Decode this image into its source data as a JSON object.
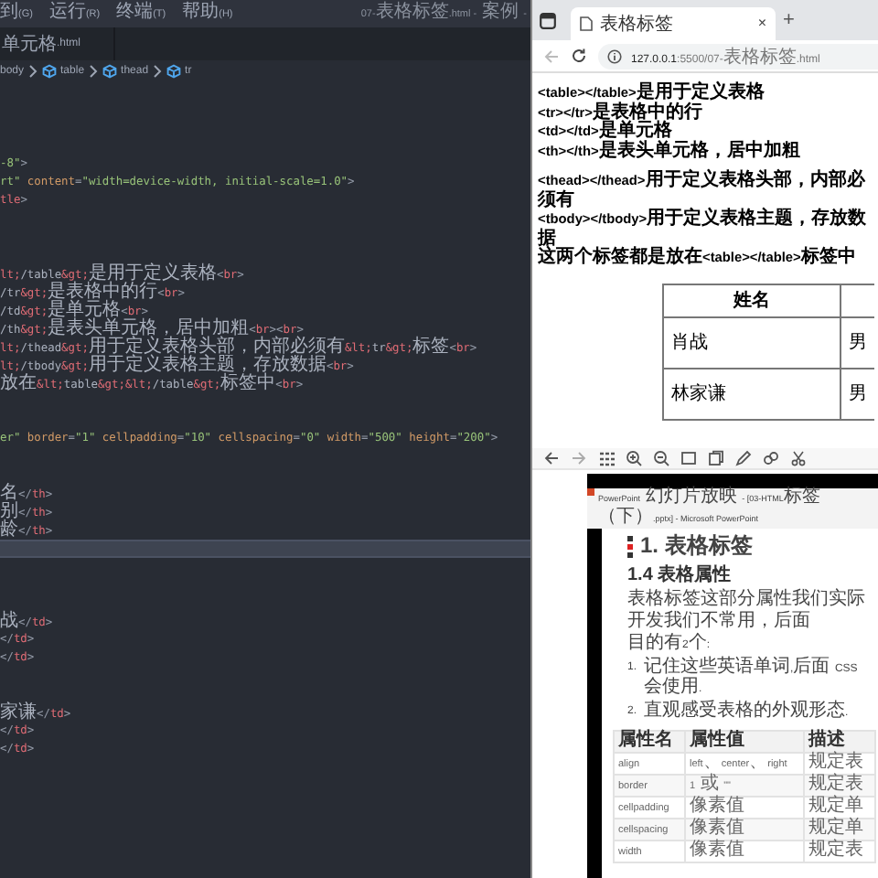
{
  "editor": {
    "menu": [
      "到(G)",
      "运行(R)",
      "终端(T)",
      "帮助(H)"
    ],
    "title": "07-表格标签.html - 案例 -",
    "tab": "单元格.html",
    "breadcrumbs": [
      {
        "text": "body",
        "icon": false
      },
      {
        "text": "table",
        "icon": true
      },
      {
        "text": "thead",
        "icon": true
      },
      {
        "text": "tr",
        "icon": true
      }
    ],
    "lines": [
      {
        "current": false
      },
      {
        "current": false
      },
      {
        "current": false
      },
      {
        "current": false
      },
      {
        "current": false,
        "tokens": [
          {
            "text": "-8\"",
            "kind": "string"
          },
          {
            "text": ">",
            "kind": "punct"
          }
        ]
      },
      {
        "current": false,
        "tokens": [
          {
            "text": "rt\"",
            "kind": "string"
          },
          {
            "text": " content",
            "kind": "attr"
          },
          {
            "text": "=",
            "kind": "punct"
          },
          {
            "text": "\"width=device-width, initial-scale=1.0\"",
            "kind": "string"
          },
          {
            "text": ">",
            "kind": "punct"
          }
        ]
      },
      {
        "current": false,
        "tokens": [
          {
            "text": "tle",
            "kind": "tag"
          },
          {
            "text": ">",
            "kind": "punct"
          }
        ]
      },
      {
        "current": false
      },
      {
        "current": false
      },
      {
        "current": false
      },
      {
        "current": false,
        "tokens": [
          {
            "text": "lt;",
            "kind": "tag"
          },
          {
            "text": "/table",
            "kind": "text"
          },
          {
            "text": "&gt;",
            "kind": "tag"
          },
          {
            "text": "是用于定义表格",
            "kind": "text"
          },
          {
            "text": "<",
            "kind": "punct"
          },
          {
            "text": "br",
            "kind": "tag"
          },
          {
            "text": ">",
            "kind": "punct"
          }
        ]
      },
      {
        "current": false,
        "tokens": [
          {
            "text": "/tr",
            "kind": "text"
          },
          {
            "text": "&gt;",
            "kind": "tag"
          },
          {
            "text": "是表格中的行",
            "kind": "text"
          },
          {
            "text": "<",
            "kind": "punct"
          },
          {
            "text": "br",
            "kind": "tag"
          },
          {
            "text": ">",
            "kind": "punct"
          }
        ]
      },
      {
        "current": false,
        "tokens": [
          {
            "text": "/td",
            "kind": "text"
          },
          {
            "text": "&gt;",
            "kind": "tag"
          },
          {
            "text": "是单元格",
            "kind": "text"
          },
          {
            "text": "<",
            "kind": "punct"
          },
          {
            "text": "br",
            "kind": "tag"
          },
          {
            "text": ">",
            "kind": "punct"
          }
        ]
      },
      {
        "current": false,
        "tokens": [
          {
            "text": "/th",
            "kind": "text"
          },
          {
            "text": "&gt;",
            "kind": "tag"
          },
          {
            "text": "是表头单元格，居中加粗",
            "kind": "text"
          },
          {
            "text": "<",
            "kind": "punct"
          },
          {
            "text": "br",
            "kind": "tag"
          },
          {
            "text": "><",
            "kind": "punct"
          },
          {
            "text": "br",
            "kind": "tag"
          },
          {
            "text": ">",
            "kind": "punct"
          }
        ]
      },
      {
        "current": false,
        "tokens": [
          {
            "text": "lt;",
            "kind": "tag"
          },
          {
            "text": "/thead",
            "kind": "text"
          },
          {
            "text": "&gt;",
            "kind": "tag"
          },
          {
            "text": "用于定义表格头部，内部必须有",
            "kind": "text"
          },
          {
            "text": "&lt;",
            "kind": "tag"
          },
          {
            "text": "tr",
            "kind": "text"
          },
          {
            "text": "&gt;",
            "kind": "tag"
          },
          {
            "text": "标签",
            "kind": "text"
          },
          {
            "text": "<",
            "kind": "punct"
          },
          {
            "text": "br",
            "kind": "tag"
          },
          {
            "text": ">",
            "kind": "punct"
          }
        ]
      },
      {
        "current": false,
        "tokens": [
          {
            "text": "lt;",
            "kind": "tag"
          },
          {
            "text": "/tbody",
            "kind": "text"
          },
          {
            "text": "&gt;",
            "kind": "tag"
          },
          {
            "text": "用于定义表格主题，存放数据",
            "kind": "text"
          },
          {
            "text": "<",
            "kind": "punct"
          },
          {
            "text": "br",
            "kind": "tag"
          },
          {
            "text": ">",
            "kind": "punct"
          }
        ]
      },
      {
        "current": false,
        "tokens": [
          {
            "text": "放在",
            "kind": "text"
          },
          {
            "text": "&lt;",
            "kind": "tag"
          },
          {
            "text": "table",
            "kind": "text"
          },
          {
            "text": "&gt;&lt;",
            "kind": "tag"
          },
          {
            "text": "/table",
            "kind": "text"
          },
          {
            "text": "&gt;",
            "kind": "tag"
          },
          {
            "text": "标签中",
            "kind": "text"
          },
          {
            "text": "<",
            "kind": "punct"
          },
          {
            "text": "br",
            "kind": "tag"
          },
          {
            "text": ">",
            "kind": "punct"
          }
        ]
      },
      {
        "current": false
      },
      {
        "current": false
      },
      {
        "current": false,
        "tokens": [
          {
            "text": "er\"",
            "kind": "string"
          },
          {
            "text": " border",
            "kind": "attr"
          },
          {
            "text": "=",
            "kind": "punct"
          },
          {
            "text": "\"1\"",
            "kind": "string"
          },
          {
            "text": " cellpadding",
            "kind": "attr"
          },
          {
            "text": "=",
            "kind": "punct"
          },
          {
            "text": "\"10\"",
            "kind": "string"
          },
          {
            "text": " cellspacing",
            "kind": "attr"
          },
          {
            "text": "=",
            "kind": "punct"
          },
          {
            "text": "\"0\"",
            "kind": "string"
          },
          {
            "text": " width",
            "kind": "attr"
          },
          {
            "text": "=",
            "kind": "punct"
          },
          {
            "text": "\"500\"",
            "kind": "string"
          },
          {
            "text": " height",
            "kind": "attr"
          },
          {
            "text": "=",
            "kind": "punct"
          },
          {
            "text": "\"200\"",
            "kind": "string"
          },
          {
            "text": ">",
            "kind": "punct"
          }
        ]
      },
      {
        "current": false
      },
      {
        "current": false
      },
      {
        "current": false,
        "tokens": [
          {
            "text": "名",
            "kind": "text"
          },
          {
            "text": "</",
            "kind": "punct"
          },
          {
            "text": "th",
            "kind": "tag"
          },
          {
            "text": ">",
            "kind": "punct"
          }
        ]
      },
      {
        "current": false,
        "tokens": [
          {
            "text": "别",
            "kind": "text"
          },
          {
            "text": "</",
            "kind": "punct"
          },
          {
            "text": "th",
            "kind": "tag"
          },
          {
            "text": ">",
            "kind": "punct"
          }
        ]
      },
      {
        "current": false,
        "tokens": [
          {
            "text": "龄",
            "kind": "text"
          },
          {
            "text": "</",
            "kind": "punct"
          },
          {
            "text": "th",
            "kind": "tag"
          },
          {
            "text": ">",
            "kind": "punct"
          }
        ]
      },
      {
        "current": true
      },
      {
        "current": false
      },
      {
        "current": false
      },
      {
        "current": false
      },
      {
        "current": false,
        "tokens": [
          {
            "text": "战",
            "kind": "text"
          },
          {
            "text": "</",
            "kind": "punct"
          },
          {
            "text": "td",
            "kind": "tag"
          },
          {
            "text": ">",
            "kind": "punct"
          }
        ]
      },
      {
        "current": false,
        "tokens": [
          {
            "text": "</",
            "kind": "punct"
          },
          {
            "text": "td",
            "kind": "tag"
          },
          {
            "text": ">",
            "kind": "punct"
          }
        ]
      },
      {
        "current": false,
        "tokens": [
          {
            "text": "</",
            "kind": "punct"
          },
          {
            "text": "td",
            "kind": "tag"
          },
          {
            "text": ">",
            "kind": "punct"
          }
        ]
      },
      {
        "current": false
      },
      {
        "current": false
      },
      {
        "current": false,
        "tokens": [
          {
            "text": "家谦",
            "kind": "text"
          },
          {
            "text": "</",
            "kind": "punct"
          },
          {
            "text": "td",
            "kind": "tag"
          },
          {
            "text": ">",
            "kind": "punct"
          }
        ]
      },
      {
        "current": false,
        "tokens": [
          {
            "text": "</",
            "kind": "punct"
          },
          {
            "text": "td",
            "kind": "tag"
          },
          {
            "text": ">",
            "kind": "punct"
          }
        ]
      },
      {
        "current": false,
        "tokens": [
          {
            "text": "</",
            "kind": "punct"
          },
          {
            "text": "td",
            "kind": "tag"
          },
          {
            "text": ">",
            "kind": "punct"
          }
        ]
      }
    ]
  },
  "browser": {
    "tab": {
      "title": "表格标签",
      "close": "×"
    },
    "new_tab": "+",
    "url": {
      "host": "127.0.0.1",
      "path": ":5500/07-表格标签.html"
    },
    "paragraphs": [
      {
        "lines": [
          "<table></table>是用于定义表格",
          "<tr></tr>是表格中的行",
          "<td></td>是单元格",
          "<th></th>是表头单元格，居中加粗"
        ]
      },
      {
        "lines": [
          "<thead></thead>用于定义表格头部，内部必须有",
          "<tbody></tbody>用于定义表格主题，存放数据",
          "这两个标签都是放在<table></table>标签中"
        ]
      }
    ],
    "table": {
      "header": [
        "姓名"
      ],
      "rows": [
        [
          "肖战",
          "男"
        ],
        [
          "林家谦",
          "男"
        ]
      ]
    }
  },
  "viewer": {
    "window_title": "PowerPoint 幻灯片放映 - [03-HTML标签（下）.pptx] - Microsoft PowerPoint",
    "slide": {
      "title": "1. 表格标签",
      "subtitle": "1.4 表格属性",
      "paragraphs": [
        "表格标签这部分属性我们实际开发我们不常用，后面",
        "目的有2个:"
      ],
      "list": [
        {
          "number": "1.",
          "text": "记住这些英语单词,后面 CSS 会使用."
        },
        {
          "number": "2.",
          "text": "直观感受表格的外观形态."
        }
      ],
      "table": {
        "columns": [
          "属性名",
          "属性值",
          "描述"
        ],
        "rows": [
          [
            "align",
            "left、center、right",
            "规定表"
          ],
          [
            "border",
            "1 或 \"\"",
            "规定表"
          ],
          [
            "cellpadding",
            "像素值",
            "规定单"
          ],
          [
            "cellspacing",
            "像素值",
            "规定单"
          ],
          [
            "width",
            "像素值",
            "规定表"
          ]
        ]
      }
    }
  }
}
